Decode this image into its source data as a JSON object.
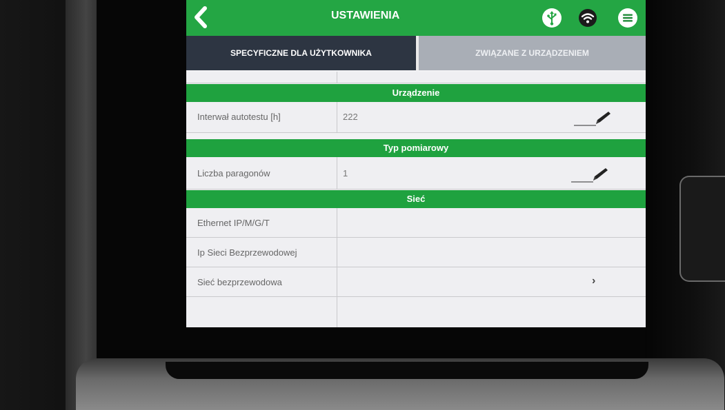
{
  "header": {
    "title": "USTAWIENIA",
    "icons": [
      "back-arrow-icon",
      "usb-icon",
      "wifi-icon",
      "menu-icon"
    ]
  },
  "tabs": [
    {
      "label": "SPECYFICZNE DLA UŻYTKOWNIKA",
      "active": true
    },
    {
      "label": "ZWIĄZANE Z URZĄDZENIEM",
      "active": false
    }
  ],
  "sections": {
    "device": {
      "title": "Urządzenie",
      "rows": [
        {
          "label": "Interwał autotestu [h]",
          "value": "222"
        }
      ]
    },
    "measure": {
      "title": "Typ pomiarowy",
      "rows": [
        {
          "label": "Liczba paragonów",
          "value": "1"
        }
      ]
    },
    "network": {
      "title": "Sieć",
      "rows": [
        {
          "label": "Ethernet IP/M/G/T",
          "value": ""
        },
        {
          "label": "Ip Sieci Bezprzewodowej",
          "value": ""
        },
        {
          "label": "Sieć bezprzewodowa",
          "value": ""
        }
      ]
    }
  },
  "colors": {
    "accent_green": "#24a644",
    "active_tab": "#2d3542",
    "inactive_tab": "#a9aeb6"
  }
}
